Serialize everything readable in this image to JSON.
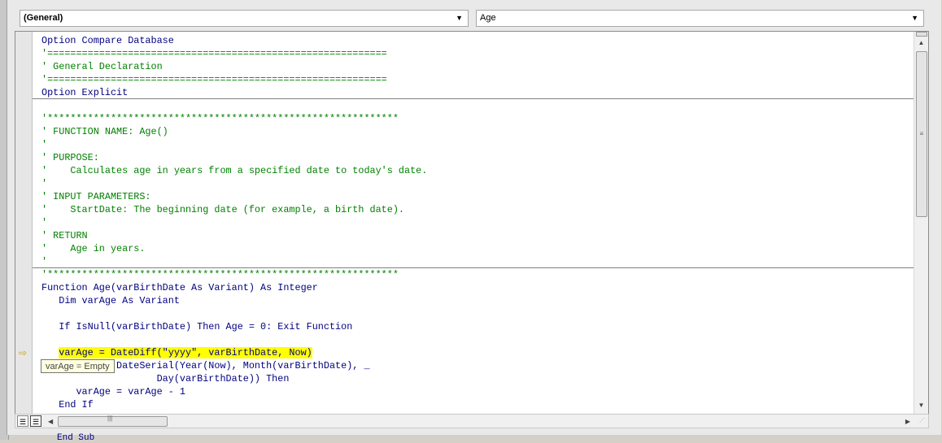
{
  "toolbar": {
    "object_combo": "(General)",
    "procedure_combo": "Age"
  },
  "code_lines": [
    {
      "text": "Option Compare Database",
      "type": "kw"
    },
    {
      "text": "'===========================================================",
      "type": "cm"
    },
    {
      "text": "' General Declaration",
      "type": "cm"
    },
    {
      "text": "'===========================================================",
      "type": "cm"
    },
    {
      "text": "Option Explicit",
      "type": "kw"
    },
    {
      "text": "",
      "type": "kw"
    },
    {
      "text": "'*************************************************************",
      "type": "cm"
    },
    {
      "text": "' FUNCTION NAME: Age()",
      "type": "cm"
    },
    {
      "text": "'",
      "type": "cm"
    },
    {
      "text": "' PURPOSE:",
      "type": "cm"
    },
    {
      "text": "'    Calculates age in years from a specified date to today's date.",
      "type": "cm"
    },
    {
      "text": "'",
      "type": "cm"
    },
    {
      "text": "' INPUT PARAMETERS:",
      "type": "cm"
    },
    {
      "text": "'    StartDate: The beginning date (for example, a birth date).",
      "type": "cm"
    },
    {
      "text": "'",
      "type": "cm"
    },
    {
      "text": "' RETURN",
      "type": "cm"
    },
    {
      "text": "'    Age in years.",
      "type": "cm"
    },
    {
      "text": "'",
      "type": "cm"
    },
    {
      "text": "'*************************************************************",
      "type": "cm"
    },
    {
      "text": "Function Age(varBirthDate As Variant) As Integer",
      "type": "kw"
    },
    {
      "text": "   Dim varAge As Variant",
      "type": "kw"
    },
    {
      "text": "",
      "type": "kw"
    },
    {
      "text": "   If IsNull(varBirthDate) Then Age = 0: Exit Function",
      "type": "kw"
    },
    {
      "text": "",
      "type": "kw"
    },
    {
      "text": "   varAge = DateDiff(\"yyyy\", varBirthDate, Now)",
      "type": "hl"
    },
    {
      "text": "   If Date < DateSerial(Year(Now), Month(varBirthDate), _",
      "type": "kw"
    },
    {
      "text": "                    Day(varBirthDate)) Then",
      "type": "kw"
    },
    {
      "text": "      varAge = varAge - 1",
      "type": "kw"
    },
    {
      "text": "   End If",
      "type": "kw"
    }
  ],
  "tooltip": "varAge = Empty",
  "bottom_partial_text": "End Sub"
}
